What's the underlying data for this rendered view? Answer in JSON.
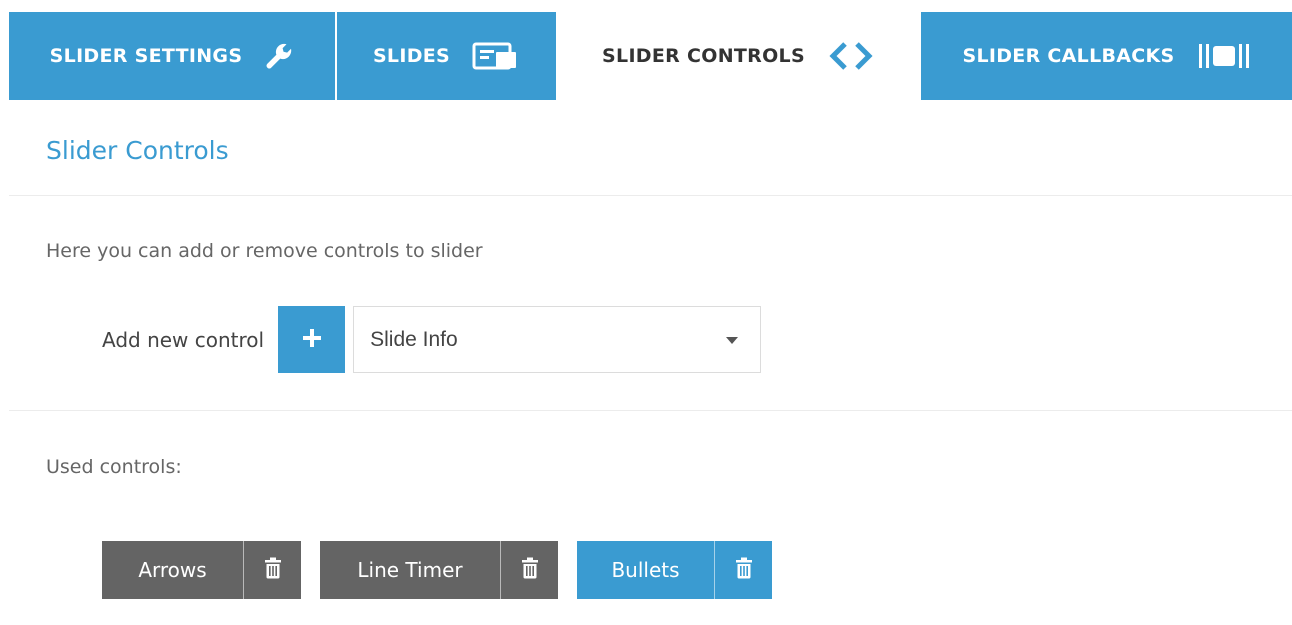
{
  "tabs": [
    {
      "label": "SLIDER SETTINGS",
      "icon": "wrench-icon"
    },
    {
      "label": "SLIDES",
      "icon": "slides-icon"
    },
    {
      "label": "SLIDER CONTROLS",
      "icon": "code-arrows-icon",
      "active": true
    },
    {
      "label": "SLIDER CALLBACKS",
      "icon": "callbacks-icon"
    }
  ],
  "section": {
    "title": "Slider Controls"
  },
  "intro": {
    "text": "Here you can add or remove controls to slider"
  },
  "add_control": {
    "label": "Add new control",
    "button_icon": "plus-icon",
    "selected": "Slide Info"
  },
  "used": {
    "label": "Used controls:",
    "controls": [
      {
        "name": "Arrows",
        "style": "gray",
        "icon": "trash-icon"
      },
      {
        "name": "Line Timer",
        "style": "gray",
        "icon": "trash-icon"
      },
      {
        "name": "Bullets",
        "style": "blue",
        "icon": "trash-icon"
      }
    ]
  },
  "colors": {
    "accent": "#3a9bd1",
    "chip_gray": "#646464",
    "text": "#555555"
  }
}
